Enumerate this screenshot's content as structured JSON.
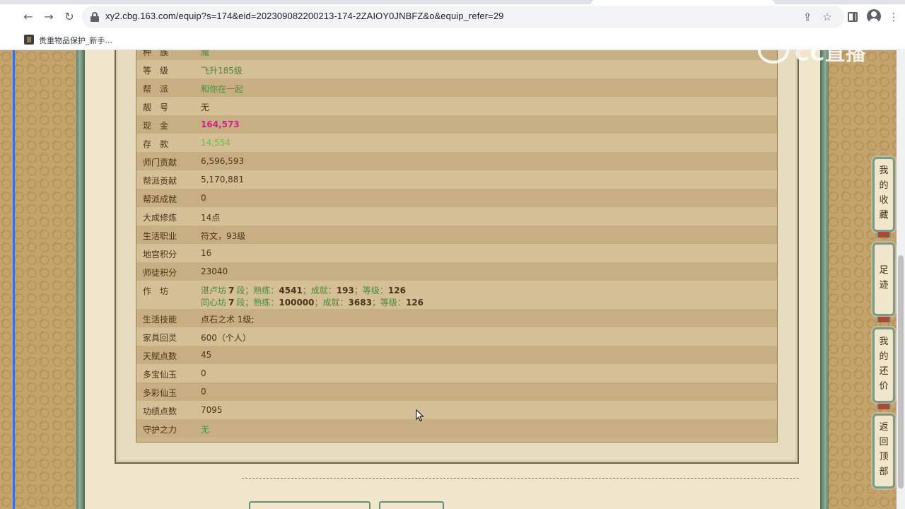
{
  "browser": {
    "url": "xy2.cbg.163.com/equip?s=174&eid=202309082200213-174-2ZAIOY0JNBFZ&o&equip_refer=29",
    "bookmark_label": "贵重物品保护_新手..."
  },
  "watermark_text": "CC直播",
  "attributes": [
    {
      "label": "种　族",
      "value": "魔",
      "style": "green",
      "partial": true
    },
    {
      "label": "等　级",
      "value": "飞升185级",
      "style": "green"
    },
    {
      "label": "帮　派",
      "value": "和你在一起",
      "style": "green"
    },
    {
      "label": "靓　号",
      "value": "无",
      "style": "dark"
    },
    {
      "label": "现　金",
      "value": "164,573",
      "style": "magenta"
    },
    {
      "label": "存　款",
      "value": "14,554",
      "style": "lime"
    },
    {
      "label": "师门贡献",
      "value": "6,596,593",
      "style": "dark"
    },
    {
      "label": "帮派贡献",
      "value": "5,170,881",
      "style": "dark"
    },
    {
      "label": "帮派成就",
      "value": "0",
      "style": "dark"
    },
    {
      "label": "大成修炼",
      "value": "14点",
      "style": "dark"
    },
    {
      "label": "生活职业",
      "value": "符文，93级",
      "style": "dark"
    },
    {
      "label": "地宫积分",
      "value": "16",
      "style": "dark"
    },
    {
      "label": "师徒积分",
      "value": "23040",
      "style": "dark"
    }
  ],
  "workshop": {
    "label": "作　坊",
    "lines": [
      {
        "name": "湛卢坊",
        "level": "7",
        "seg": "段；熟练：",
        "skill": "4541",
        "ach_label": "；成就：",
        "ach": "193",
        "grade_label": "；等级：",
        "grade": "126"
      },
      {
        "name": "同心坊",
        "level": "7",
        "seg": "段；熟练：",
        "skill": "100000",
        "ach_label": "；成就：",
        "ach": "3683",
        "grade_label": "；等级：",
        "grade": "126"
      }
    ]
  },
  "attributes2": [
    {
      "label": "生活技能",
      "value": "点石之术 1级;",
      "style": "dark"
    },
    {
      "label": "家具回灵",
      "value": "600（个人）",
      "style": "dark"
    },
    {
      "label": "天赋点数",
      "value": "45",
      "style": "dark"
    },
    {
      "label": "多宝仙玉",
      "value": "0",
      "style": "dark"
    },
    {
      "label": "多彩仙玉",
      "value": "0",
      "style": "dark"
    },
    {
      "label": "功绩点数",
      "value": "7095",
      "style": "dark"
    },
    {
      "label": "守护之力",
      "value": "无",
      "style": "green"
    }
  ],
  "float_menu": [
    {
      "chars": [
        "我",
        "的",
        "收",
        "藏"
      ]
    },
    {
      "chars": [
        "足",
        "迹"
      ]
    },
    {
      "chars": [
        "我",
        "的",
        "还",
        "价"
      ]
    },
    {
      "chars": [
        "返",
        "回",
        "顶",
        "部"
      ]
    }
  ]
}
